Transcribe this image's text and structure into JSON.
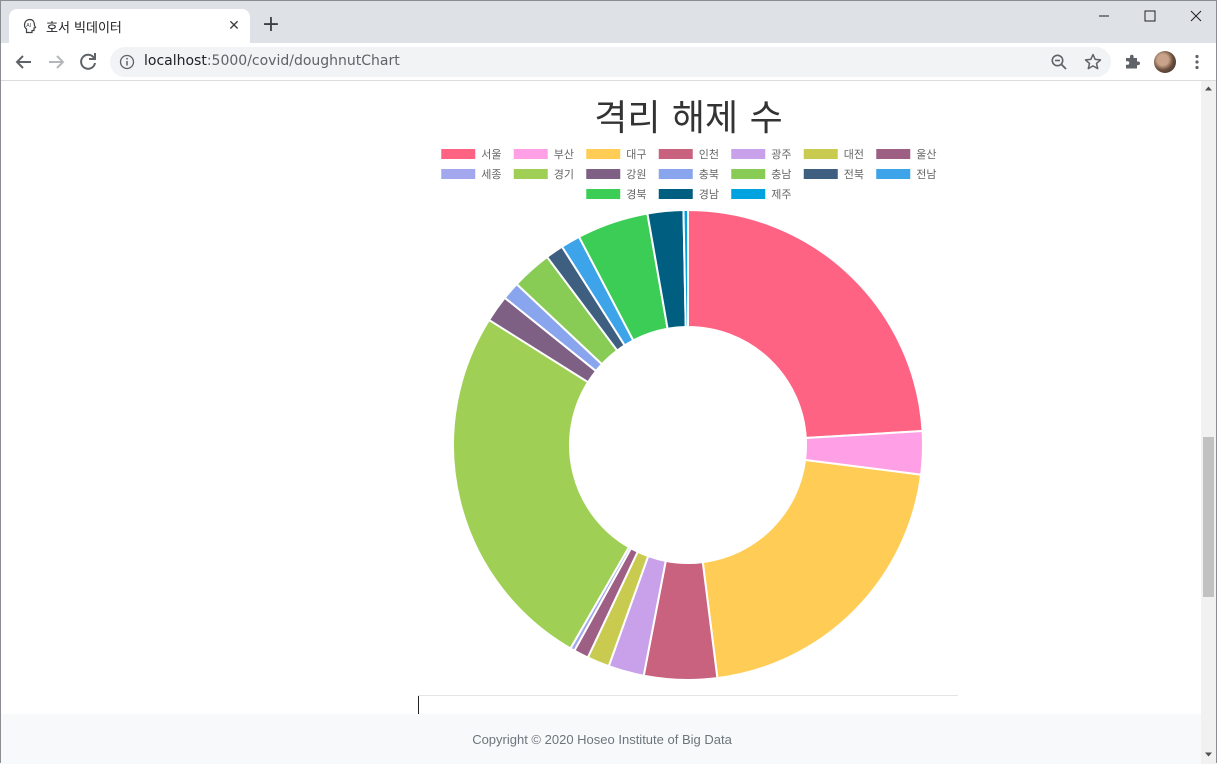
{
  "browser": {
    "tab_title": "호서 빅데이터",
    "url_host": "localhost",
    "url_rest": ":5000/covid/doughnutChart",
    "colors": {
      "tabstrip": "#dee1e6",
      "omnibox": "#f1f3f4"
    }
  },
  "page": {
    "footer": "Copyright © 2020 Hoseo Institute of Big Data"
  },
  "chart_data": {
    "type": "doughnut",
    "title": "격리 해제 수",
    "legend_position": "top",
    "categories": [
      "서울",
      "부산",
      "대구",
      "인천",
      "광주",
      "대전",
      "울산",
      "세종",
      "경기",
      "강원",
      "충북",
      "충남",
      "전북",
      "전남",
      "경북",
      "경남",
      "제주"
    ],
    "values": [
      23500,
      2900,
      20500,
      4900,
      2400,
      1500,
      1000,
      300,
      25000,
      1800,
      1200,
      2700,
      1200,
      1300,
      4800,
      2400,
      300
    ],
    "colors": [
      "#ff6384",
      "#ffa0e7",
      "#ffcd56",
      "#c8627f",
      "#c9a0ea",
      "#c9cb50",
      "#9e5f84",
      "#a3a8ee",
      "#a0cf55",
      "#7f6085",
      "#88a5ee",
      "#88cb55",
      "#3f5f80",
      "#3ea4ea",
      "#3bcd56",
      "#005f80",
      "#00a2e0"
    ]
  }
}
